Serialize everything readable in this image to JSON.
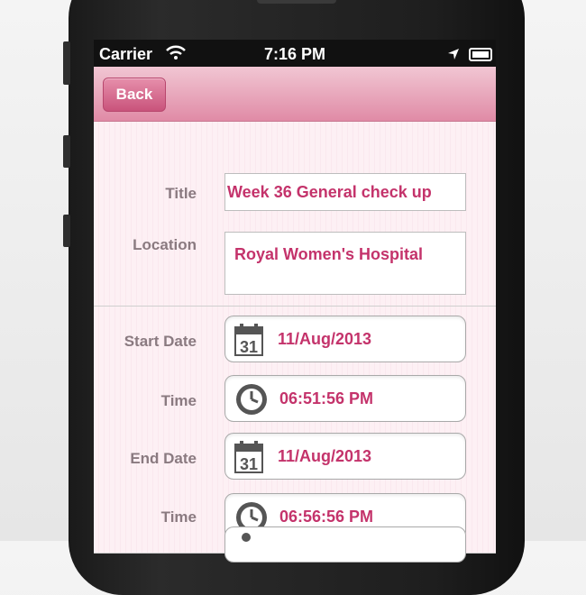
{
  "status_bar": {
    "carrier": "Carrier",
    "time": "7:16 PM"
  },
  "nav": {
    "back_label": "Back"
  },
  "form": {
    "title_label": "Title",
    "title_value": "Week 36 General check up",
    "location_label": "Location",
    "location_value": "Royal Women's Hospital",
    "start_date_label": "Start Date",
    "start_date_value": "11/Aug/2013",
    "start_time_label": "Time",
    "start_time_value": "06:51:56 PM",
    "end_date_label": "End Date",
    "end_date_value": "11/Aug/2013",
    "end_time_label": "Time",
    "end_time_value": "06:56:56 PM",
    "calendar_icon_text": "31"
  },
  "colors": {
    "accent": "#c4336b",
    "nav_top": "#f1c6d3",
    "nav_bottom": "#e08ba6",
    "label": "#8a7a80"
  }
}
